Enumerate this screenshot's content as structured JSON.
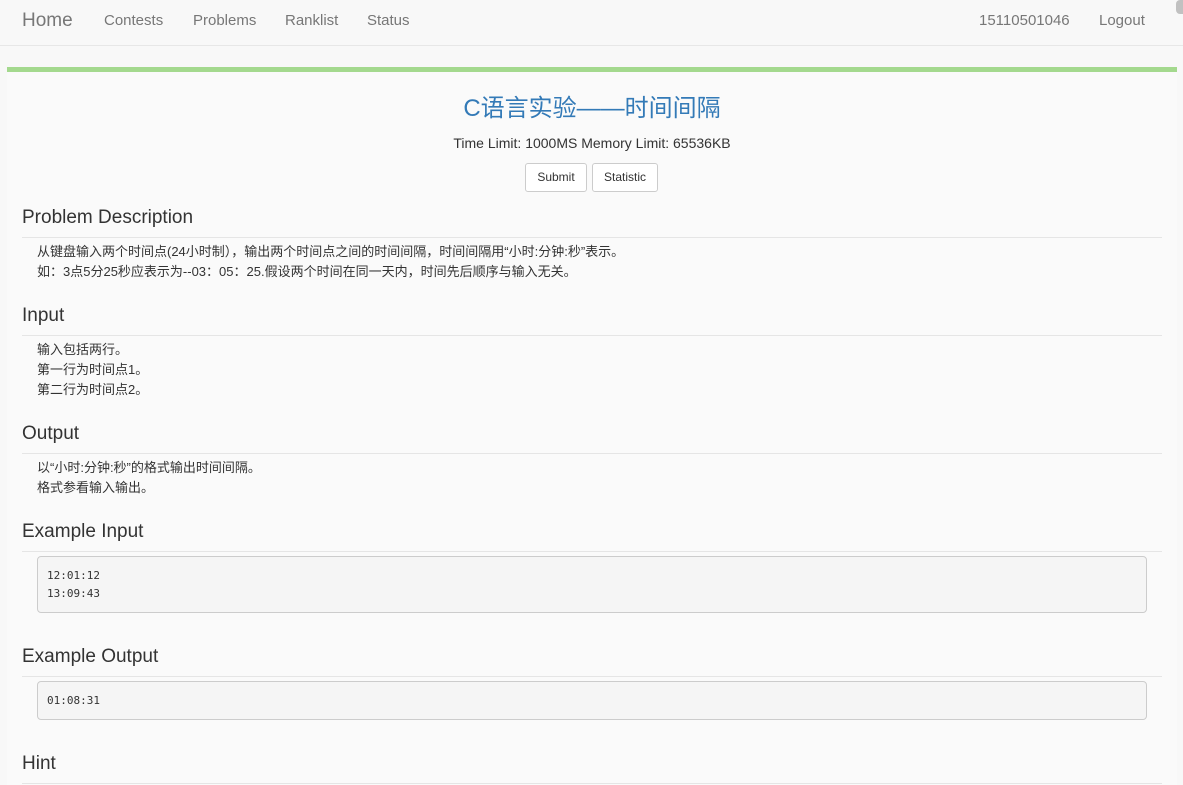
{
  "nav": {
    "brand": "Home",
    "links": [
      "Contests",
      "Problems",
      "Ranklist",
      "Status"
    ],
    "user": "15110501046",
    "logout": "Logout"
  },
  "problem": {
    "title": "C语言实验——时间间隔",
    "limits": "Time Limit: 1000MS Memory Limit: 65536KB",
    "submit_label": "Submit",
    "statistic_label": "Statistic"
  },
  "sections": {
    "description": {
      "heading": "Problem Description",
      "lines": [
        "从键盘输入两个时间点(24小时制），输出两个时间点之间的时间间隔，时间间隔用“小时:分钟:秒”表示。",
        "如：3点5分25秒应表示为--03：05：25.假设两个时间在同一天内，时间先后顺序与输入无关。"
      ]
    },
    "input": {
      "heading": "Input",
      "lines": [
        "输入包括两行。",
        "第一行为时间点1。",
        "第二行为时间点2。"
      ]
    },
    "output": {
      "heading": "Output",
      "lines": [
        "以“小时:分钟:秒”的格式输出时间间隔。",
        "格式参看输入输出。"
      ]
    },
    "example_input": {
      "heading": "Example Input",
      "text": "12:01:12\n13:09:43"
    },
    "example_output": {
      "heading": "Example Output",
      "text": "01:08:31"
    },
    "hint": {
      "heading": "Hint"
    }
  },
  "colors": {
    "title": "#337ab7",
    "panel_accent": "#a4d98e"
  }
}
